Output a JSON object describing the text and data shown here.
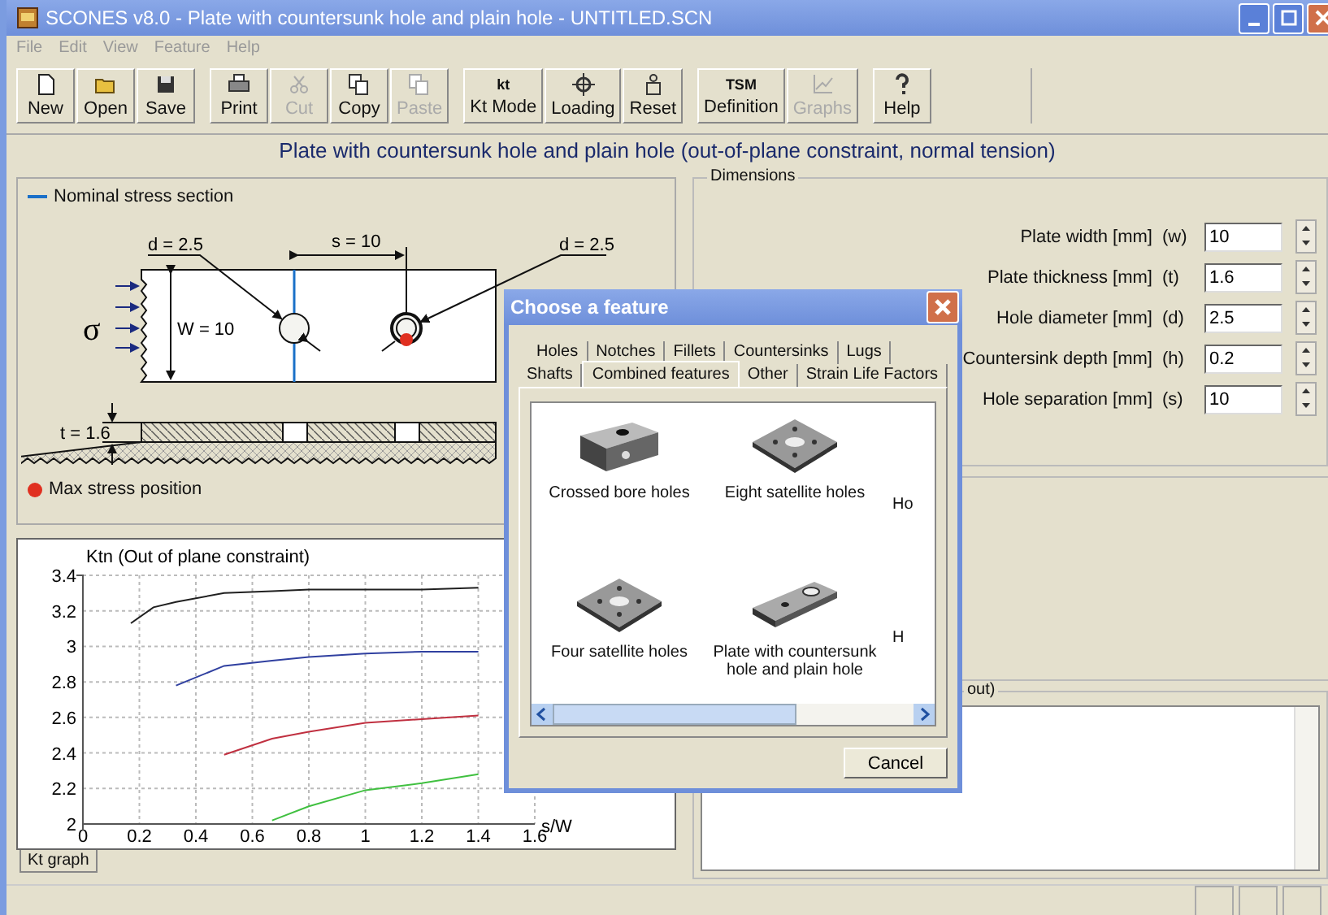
{
  "window": {
    "title": "SCONES v8.0 - Plate with countersunk hole and plain hole - UNTITLED.SCN"
  },
  "menu": [
    {
      "label": "File"
    },
    {
      "label": "Edit"
    },
    {
      "label": "View"
    },
    {
      "label": "Feature"
    },
    {
      "label": "Help"
    }
  ],
  "toolbar": [
    {
      "label": "New",
      "kind": "page",
      "disabled": false
    },
    {
      "label": "Open",
      "kind": "folder",
      "disabled": false
    },
    {
      "label": "Save",
      "kind": "disk",
      "disabled": false
    },
    {
      "label": "Print",
      "kind": "printer",
      "disabled": false
    },
    {
      "label": "Cut",
      "kind": "scissors",
      "disabled": true
    },
    {
      "label": "Copy",
      "kind": "copy",
      "disabled": false
    },
    {
      "label": "Paste",
      "kind": "copy",
      "disabled": true
    },
    {
      "label": "Kt Mode",
      "kind": "text",
      "icon_text": "kt",
      "disabled": false
    },
    {
      "label": "Loading",
      "kind": "target",
      "disabled": false
    },
    {
      "label": "Reset",
      "kind": "weight",
      "disabled": false
    },
    {
      "label": "Definition",
      "kind": "text",
      "icon_text": "TSM",
      "disabled": false
    },
    {
      "label": "Graphs",
      "kind": "chart",
      "disabled": true
    },
    {
      "label": "Help",
      "kind": "question",
      "disabled": false
    }
  ],
  "heading": "Plate with countersunk hole and plain hole (out-of-plane constraint, normal tension)",
  "diagram": {
    "legend_section": "Nominal stress section",
    "legend_max": "Max stress position",
    "labels": {
      "d_left": "d = 2.5",
      "s": "s = 10",
      "d_right": "d = 2.5",
      "w": "W = 10",
      "sigma": "σ",
      "t": "t = 1.6"
    }
  },
  "chart_panel": {
    "tab": "Kt graph",
    "chart_data": {
      "type": "line",
      "ylabel": "Ktn (Out of plane constraint)",
      "xlabel": "s/W",
      "grid": true,
      "x": [
        0.17,
        0.25,
        0.33,
        0.5,
        0.67,
        0.8,
        1,
        1.2,
        1.4
      ],
      "xlim": [
        0,
        1.6
      ],
      "ylim": [
        2,
        3.4
      ],
      "xticks": [
        0,
        0.2,
        0.4,
        0.6,
        0.8,
        1,
        1.2,
        1.4,
        1.6
      ],
      "yticks": [
        2,
        2.2,
        2.4,
        2.6,
        2.8,
        3,
        3.2,
        3.4
      ],
      "series": [
        {
          "color": "#202020",
          "values": [
            3.13,
            3.22,
            3.25,
            3.3,
            3.31,
            3.32,
            3.32,
            3.32,
            3.33
          ]
        },
        {
          "color": "#3040a0",
          "values": [
            null,
            null,
            2.78,
            2.89,
            2.92,
            2.94,
            2.96,
            2.97,
            2.97
          ]
        },
        {
          "color": "#c03040",
          "values": [
            null,
            null,
            null,
            2.39,
            2.48,
            2.52,
            2.57,
            2.59,
            2.61
          ]
        },
        {
          "color": "#40c040",
          "values": [
            null,
            null,
            null,
            null,
            2.02,
            2.1,
            2.19,
            2.23,
            2.28
          ]
        }
      ]
    }
  },
  "dimensions": {
    "title": "Dimensions",
    "fields": [
      {
        "label": "Plate width [mm]",
        "symbol": "(w)",
        "value": "10"
      },
      {
        "label": "Plate thickness [mm]",
        "symbol": "(t)",
        "value": "1.6"
      },
      {
        "label": "Hole diameter [mm]",
        "symbol": "(d)",
        "value": "2.5"
      },
      {
        "label": "Countersink depth [mm]",
        "symbol": "(h)",
        "value": "0.2"
      },
      {
        "label": "Hole separation [mm]",
        "symbol": "(s)",
        "value": "10"
      }
    ]
  },
  "output": {
    "title": "out)"
  },
  "dialog": {
    "title": "Choose a feature",
    "tab_rows": [
      [
        {
          "label": "Holes",
          "selected": false
        },
        {
          "label": "Notches",
          "selected": false
        },
        {
          "label": "Fillets",
          "selected": false
        },
        {
          "label": "Countersinks",
          "selected": false
        },
        {
          "label": "Lugs",
          "selected": false
        }
      ],
      [
        {
          "label": "Shafts",
          "selected": false
        },
        {
          "label": "Combined features",
          "selected": true
        },
        {
          "label": "Other",
          "selected": false
        },
        {
          "label": "Strain Life Factors",
          "selected": false
        }
      ]
    ],
    "items": [
      {
        "label": "Crossed bore holes",
        "kind": "block"
      },
      {
        "label": "Eight satellite holes",
        "kind": "perforated"
      },
      {
        "label": "Ho"
      },
      {
        "label": "Four satellite holes",
        "kind": "perforated"
      },
      {
        "label": "Plate with countersunk hole and plain hole",
        "kind": "plate"
      },
      {
        "label": "H"
      }
    ],
    "cancel": "Cancel"
  }
}
